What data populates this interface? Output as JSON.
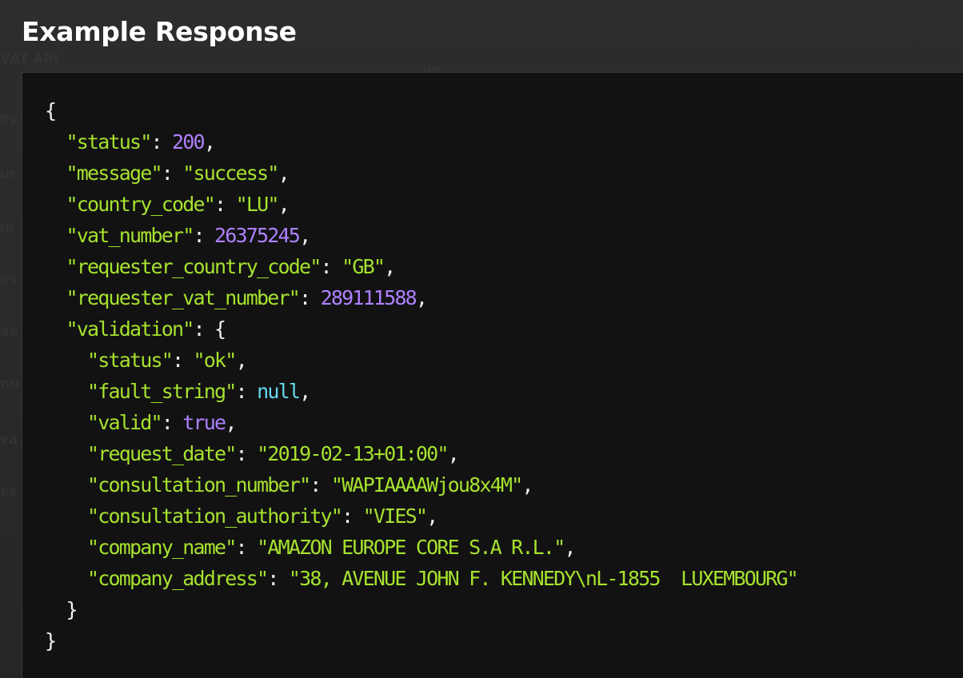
{
  "page": {
    "title": "Example Response"
  },
  "background_fragments": [
    "VAT API",
    "on",
    "ey",
    "ur",
    "in",
    "os",
    "aa",
    "nu",
    "va",
    "es"
  ],
  "colors": {
    "string": "#a6e22e",
    "number": "#ae81ff",
    "boolean": "#ae81ff",
    "null": "#66d9ef",
    "punctuation": "#f0f0f0",
    "panel_background": "#121212",
    "page_background": "#2a2a2a"
  },
  "response": {
    "open_brace": "{",
    "close_brace": "}",
    "status_key": "\"status\"",
    "status_value": "200",
    "message_key": "\"message\"",
    "message_value": "\"success\"",
    "country_code_key": "\"country_code\"",
    "country_code_value": "\"LU\"",
    "vat_number_key": "\"vat_number\"",
    "vat_number_value": "26375245",
    "requester_country_code_key": "\"requester_country_code\"",
    "requester_country_code_value": "\"GB\"",
    "requester_vat_number_key": "\"requester_vat_number\"",
    "requester_vat_number_value": "289111588",
    "validation_key": "\"validation\"",
    "validation": {
      "open_brace": "{",
      "close_brace": "}",
      "status_key": "\"status\"",
      "status_value": "\"ok\"",
      "fault_string_key": "\"fault_string\"",
      "fault_string_value": "null",
      "valid_key": "\"valid\"",
      "valid_value": "true",
      "request_date_key": "\"request_date\"",
      "request_date_value": "\"2019-02-13+01:00\"",
      "consultation_number_key": "\"consultation_number\"",
      "consultation_number_value": "\"WAPIAAAAWjou8x4M\"",
      "consultation_authority_key": "\"consultation_authority\"",
      "consultation_authority_value": "\"VIES\"",
      "company_name_key": "\"company_name\"",
      "company_name_value": "\"AMAZON EUROPE CORE S.A R.L.\"",
      "company_address_key": "\"company_address\"",
      "company_address_value": "\"38, AVENUE JOHN F. KENNEDY\\nL-1855  LUXEMBOURG\""
    }
  }
}
